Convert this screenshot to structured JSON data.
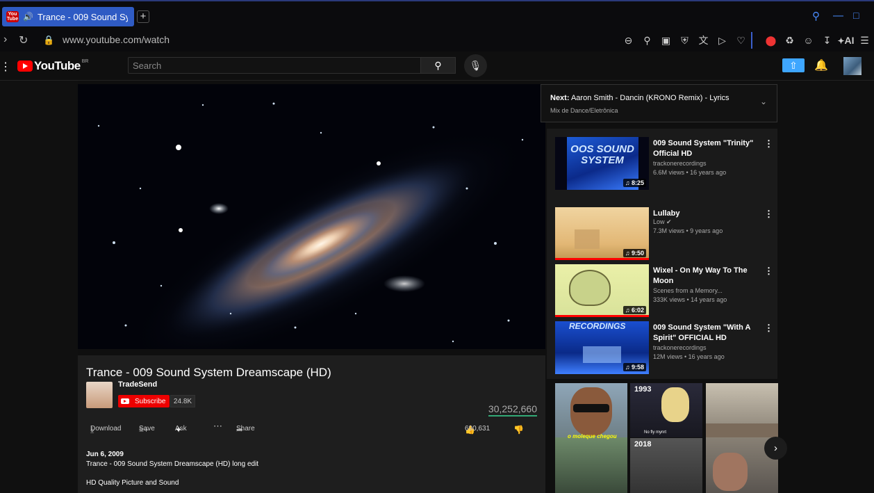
{
  "browser": {
    "tab_title": "Trance - 009 Sound Sy",
    "favicon_text": "You Tube",
    "url": "www.youtube.com/watch",
    "ai_label": "AI"
  },
  "youtube": {
    "logo_text": "YouTube",
    "country_code": "BR",
    "search_placeholder": "Search"
  },
  "video": {
    "title": "Trance - 009 Sound System Dreamscape (HD)",
    "channel": "TradeSend",
    "subscribe_label": "Subscribe",
    "subscriber_count": "24.8K",
    "views": "30,252,660",
    "actions": {
      "download": "Download",
      "save": "Save",
      "ask": "Ask",
      "more": "⋯",
      "share": "Share",
      "likes": "690,631"
    },
    "description": {
      "date": "Jun 6, 2009",
      "line1": "Trance - 009 Sound System Dreamscape (HD) long edit",
      "line2": "HD Quality Picture and Sound"
    }
  },
  "up_next": {
    "label": "Next:",
    "title": "Aaron Smith - Dancin (KRONO Remix) - Lyrics",
    "mix": "Mix de Dance/Eletrônica"
  },
  "recommendations": [
    {
      "title": "009 Sound System \"Trinity\" Official HD",
      "channel": "trackonerecordings",
      "meta": "6.6M views • 16 years ago",
      "duration": "8:25",
      "thumb_text": "OOS SOUND SYSTEM"
    },
    {
      "title": "Lullaby",
      "channel": "Low",
      "meta": "7.3M views • 9 years ago",
      "duration": "9:50"
    },
    {
      "title": "Wixel - On My Way To The Moon",
      "channel": "Scenes from a Memory...",
      "meta": "333K views • 14 years ago",
      "duration": "6:02"
    },
    {
      "title": "009 Sound System \"With A Spirit\" OFFICIAL HD",
      "channel": "trackonerecordings",
      "meta": "12M views • 16 years ago",
      "duration": "9:58",
      "thumb_text": "RECORDINGS"
    }
  ],
  "shorts": [
    {
      "caption": "o moleque chegou"
    },
    {
      "caption_top": "1993",
      "caption_mid": "No fly mynrt",
      "caption_bottom": "2018"
    },
    {
      "caption": ""
    }
  ]
}
